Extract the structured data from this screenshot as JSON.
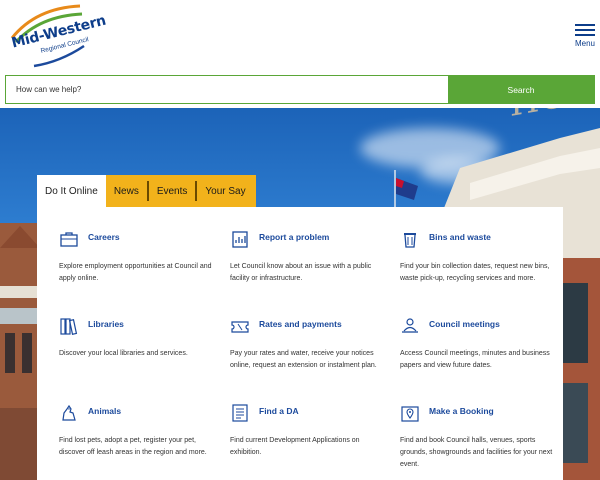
{
  "header": {
    "logo_line1": "Mid-Western",
    "logo_line2": "Regional Council",
    "menu_label": "Menu"
  },
  "search": {
    "placeholder": "How can we help?",
    "button_label": "Search"
  },
  "tabs": [
    {
      "label": "Do It Online",
      "active": true
    },
    {
      "label": "News",
      "active": false
    },
    {
      "label": "Events",
      "active": false
    },
    {
      "label": "Your Say",
      "active": false
    }
  ],
  "cards": [
    {
      "title": "Careers",
      "icon": "briefcase-icon",
      "description": "Explore employment opportunities at Council and apply online."
    },
    {
      "title": "Report a problem",
      "icon": "report-clipboard-icon",
      "description": "Let Council know about an issue with a public facility or infrastructure."
    },
    {
      "title": "Bins and waste",
      "icon": "bin-icon",
      "description": "Find your bin collection dates, request new bins, waste pick-up, recycling services and more."
    },
    {
      "title": "Libraries",
      "icon": "books-icon",
      "description": "Discover your local libraries and services."
    },
    {
      "title": "Rates and payments",
      "icon": "ticket-icon",
      "description": "Pay your rates and water, receive your notices online, request an extension or instalment plan."
    },
    {
      "title": "Council meetings",
      "icon": "meeting-person-icon",
      "description": "Access Council meetings, minutes and business papers and view future dates."
    },
    {
      "title": "Animals",
      "icon": "dog-icon",
      "description": "Find lost pets, adopt a pet, register your pet, discover off leash areas in the region and more."
    },
    {
      "title": "Find a DA",
      "icon": "document-list-icon",
      "description": "Find current Development Applications on exhibition."
    },
    {
      "title": "Make a Booking",
      "icon": "map-pin-icon",
      "description": "Find and book Council halls, venues, sports grounds, showgrounds and facilities for your next event."
    }
  ],
  "colors": {
    "brand_blue": "#1c4a9c",
    "brand_green": "#5aa637",
    "tab_yellow": "#f2b21b"
  }
}
